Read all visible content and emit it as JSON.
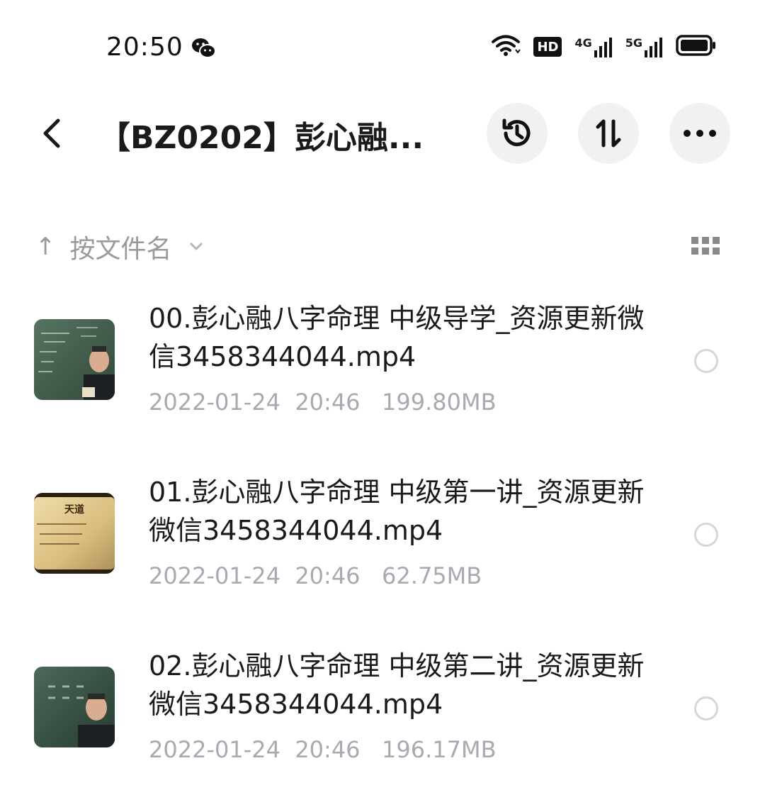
{
  "status_bar": {
    "time": "20:50",
    "hd_badge": "HD",
    "network1": "4G",
    "network2": "5G"
  },
  "header": {
    "title": "【BZ0202】彭心融..."
  },
  "sort": {
    "arrow": "↑",
    "label": "按文件名"
  },
  "files": [
    {
      "name": "00.彭心融八字命理 中级导学_资源更新微信3458344044.mp4",
      "date": "2022-01-24",
      "time": "20:46",
      "size": "199.80MB"
    },
    {
      "name": "01.彭心融八字命理 中级第一讲_资源更新微信3458344044.mp4",
      "date": "2022-01-24",
      "time": "20:46",
      "size": "62.75MB",
      "thumb_title": "天道"
    },
    {
      "name": "02.彭心融八字命理 中级第二讲_资源更新微信3458344044.mp4",
      "date": "2022-01-24",
      "time": "20:46",
      "size": "196.17MB"
    }
  ]
}
